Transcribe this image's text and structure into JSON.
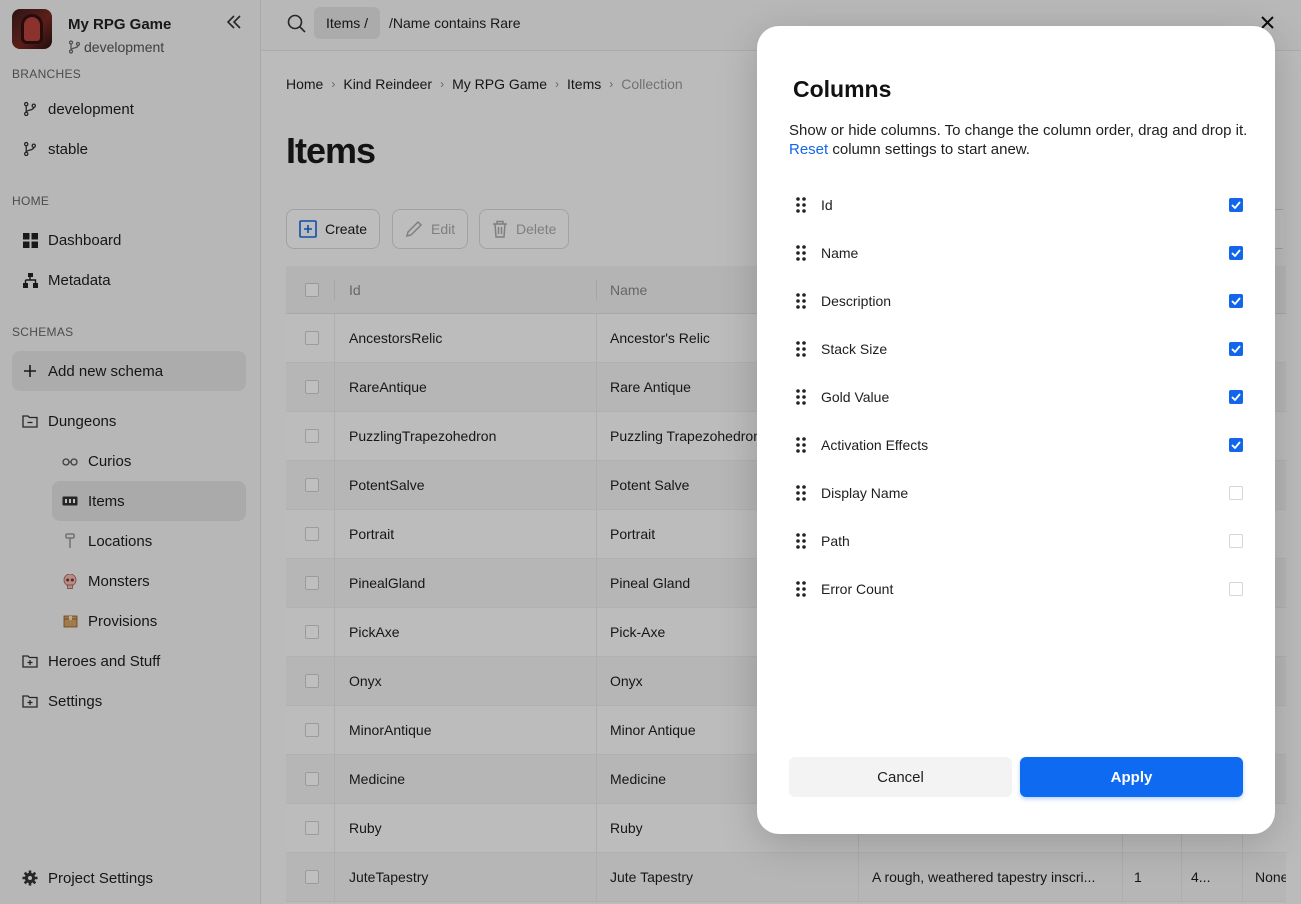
{
  "app": {
    "title": "My RPG Game",
    "branch": "development"
  },
  "sidebar": {
    "branches_label": "BRANCHES",
    "branches": [
      "development",
      "stable"
    ],
    "home_label": "HOME",
    "home": [
      "Dashboard",
      "Metadata"
    ],
    "schemas_label": "SCHEMAS",
    "add_schema": "Add new schema",
    "folders": {
      "dungeons": "Dungeons",
      "dungeon_children": [
        "Curios",
        "Items",
        "Locations",
        "Monsters",
        "Provisions"
      ],
      "heroes": "Heroes and Stuff",
      "settings": "Settings"
    },
    "project_settings": "Project Settings"
  },
  "search": {
    "chip": "Items /",
    "value": "/Name contains Rare"
  },
  "breadcrumb": [
    "Home",
    "Kind Reindeer",
    "My RPG Game",
    "Items"
  ],
  "breadcrumb_current": "Collection",
  "page_title": "Items",
  "toolbar": {
    "create": "Create",
    "edit": "Edit",
    "delete": "Delete"
  },
  "table": {
    "headers": [
      "Id",
      "Name"
    ],
    "rows": [
      {
        "id": "AncestorsRelic",
        "name": "Ancestor's Relic",
        "desc": "",
        "stack": "",
        "gold": "",
        "extra": ""
      },
      {
        "id": "RareAntique",
        "name": "Rare Antique",
        "desc": "",
        "stack": "",
        "gold": "",
        "extra": ""
      },
      {
        "id": "PuzzlingTrapezohedron",
        "name": "Puzzling Trapezohedron",
        "desc": "",
        "stack": "",
        "gold": "",
        "extra": ""
      },
      {
        "id": "PotentSalve",
        "name": "Potent Salve",
        "desc": "",
        "stack": "",
        "gold": "",
        "extra": ""
      },
      {
        "id": "Portrait",
        "name": "Portrait",
        "desc": "",
        "stack": "",
        "gold": "",
        "extra": ""
      },
      {
        "id": "PinealGland",
        "name": "Pineal Gland",
        "desc": "",
        "stack": "",
        "gold": "",
        "extra": ""
      },
      {
        "id": "PickAxe",
        "name": "Pick-Axe",
        "desc": "",
        "stack": "",
        "gold": "",
        "extra": ""
      },
      {
        "id": "Onyx",
        "name": "Onyx",
        "desc": "",
        "stack": "",
        "gold": "",
        "extra": ""
      },
      {
        "id": "MinorAntique",
        "name": "Minor Antique",
        "desc": "",
        "stack": "",
        "gold": "",
        "extra": ""
      },
      {
        "id": "Medicine",
        "name": "Medicine",
        "desc": "",
        "stack": "",
        "gold": "",
        "extra": ""
      },
      {
        "id": "Ruby",
        "name": "Ruby",
        "desc": "",
        "stack": "",
        "gold": "",
        "extra": ""
      },
      {
        "id": "JuteTapestry",
        "name": "Jute Tapestry",
        "desc": "A rough, weathered tapestry inscri...",
        "stack": "1",
        "gold": "4...",
        "extra": "None"
      }
    ]
  },
  "modal": {
    "title": "Columns",
    "desc_text": "Show or hide columns. To change the column order, drag and drop it.",
    "reset_link": "Reset",
    "reset_suffix": " column settings to start anew.",
    "columns": [
      {
        "label": "Id",
        "checked": true
      },
      {
        "label": "Name",
        "checked": true
      },
      {
        "label": "Description",
        "checked": true
      },
      {
        "label": "Stack Size",
        "checked": true
      },
      {
        "label": "Gold Value",
        "checked": true
      },
      {
        "label": "Activation Effects",
        "checked": true
      },
      {
        "label": "Display Name",
        "checked": false
      },
      {
        "label": "Path",
        "checked": false
      },
      {
        "label": "Error Count",
        "checked": false
      }
    ],
    "cancel": "Cancel",
    "apply": "Apply"
  },
  "colors": {
    "accent": "#0f6af2",
    "link": "#1366e9"
  }
}
